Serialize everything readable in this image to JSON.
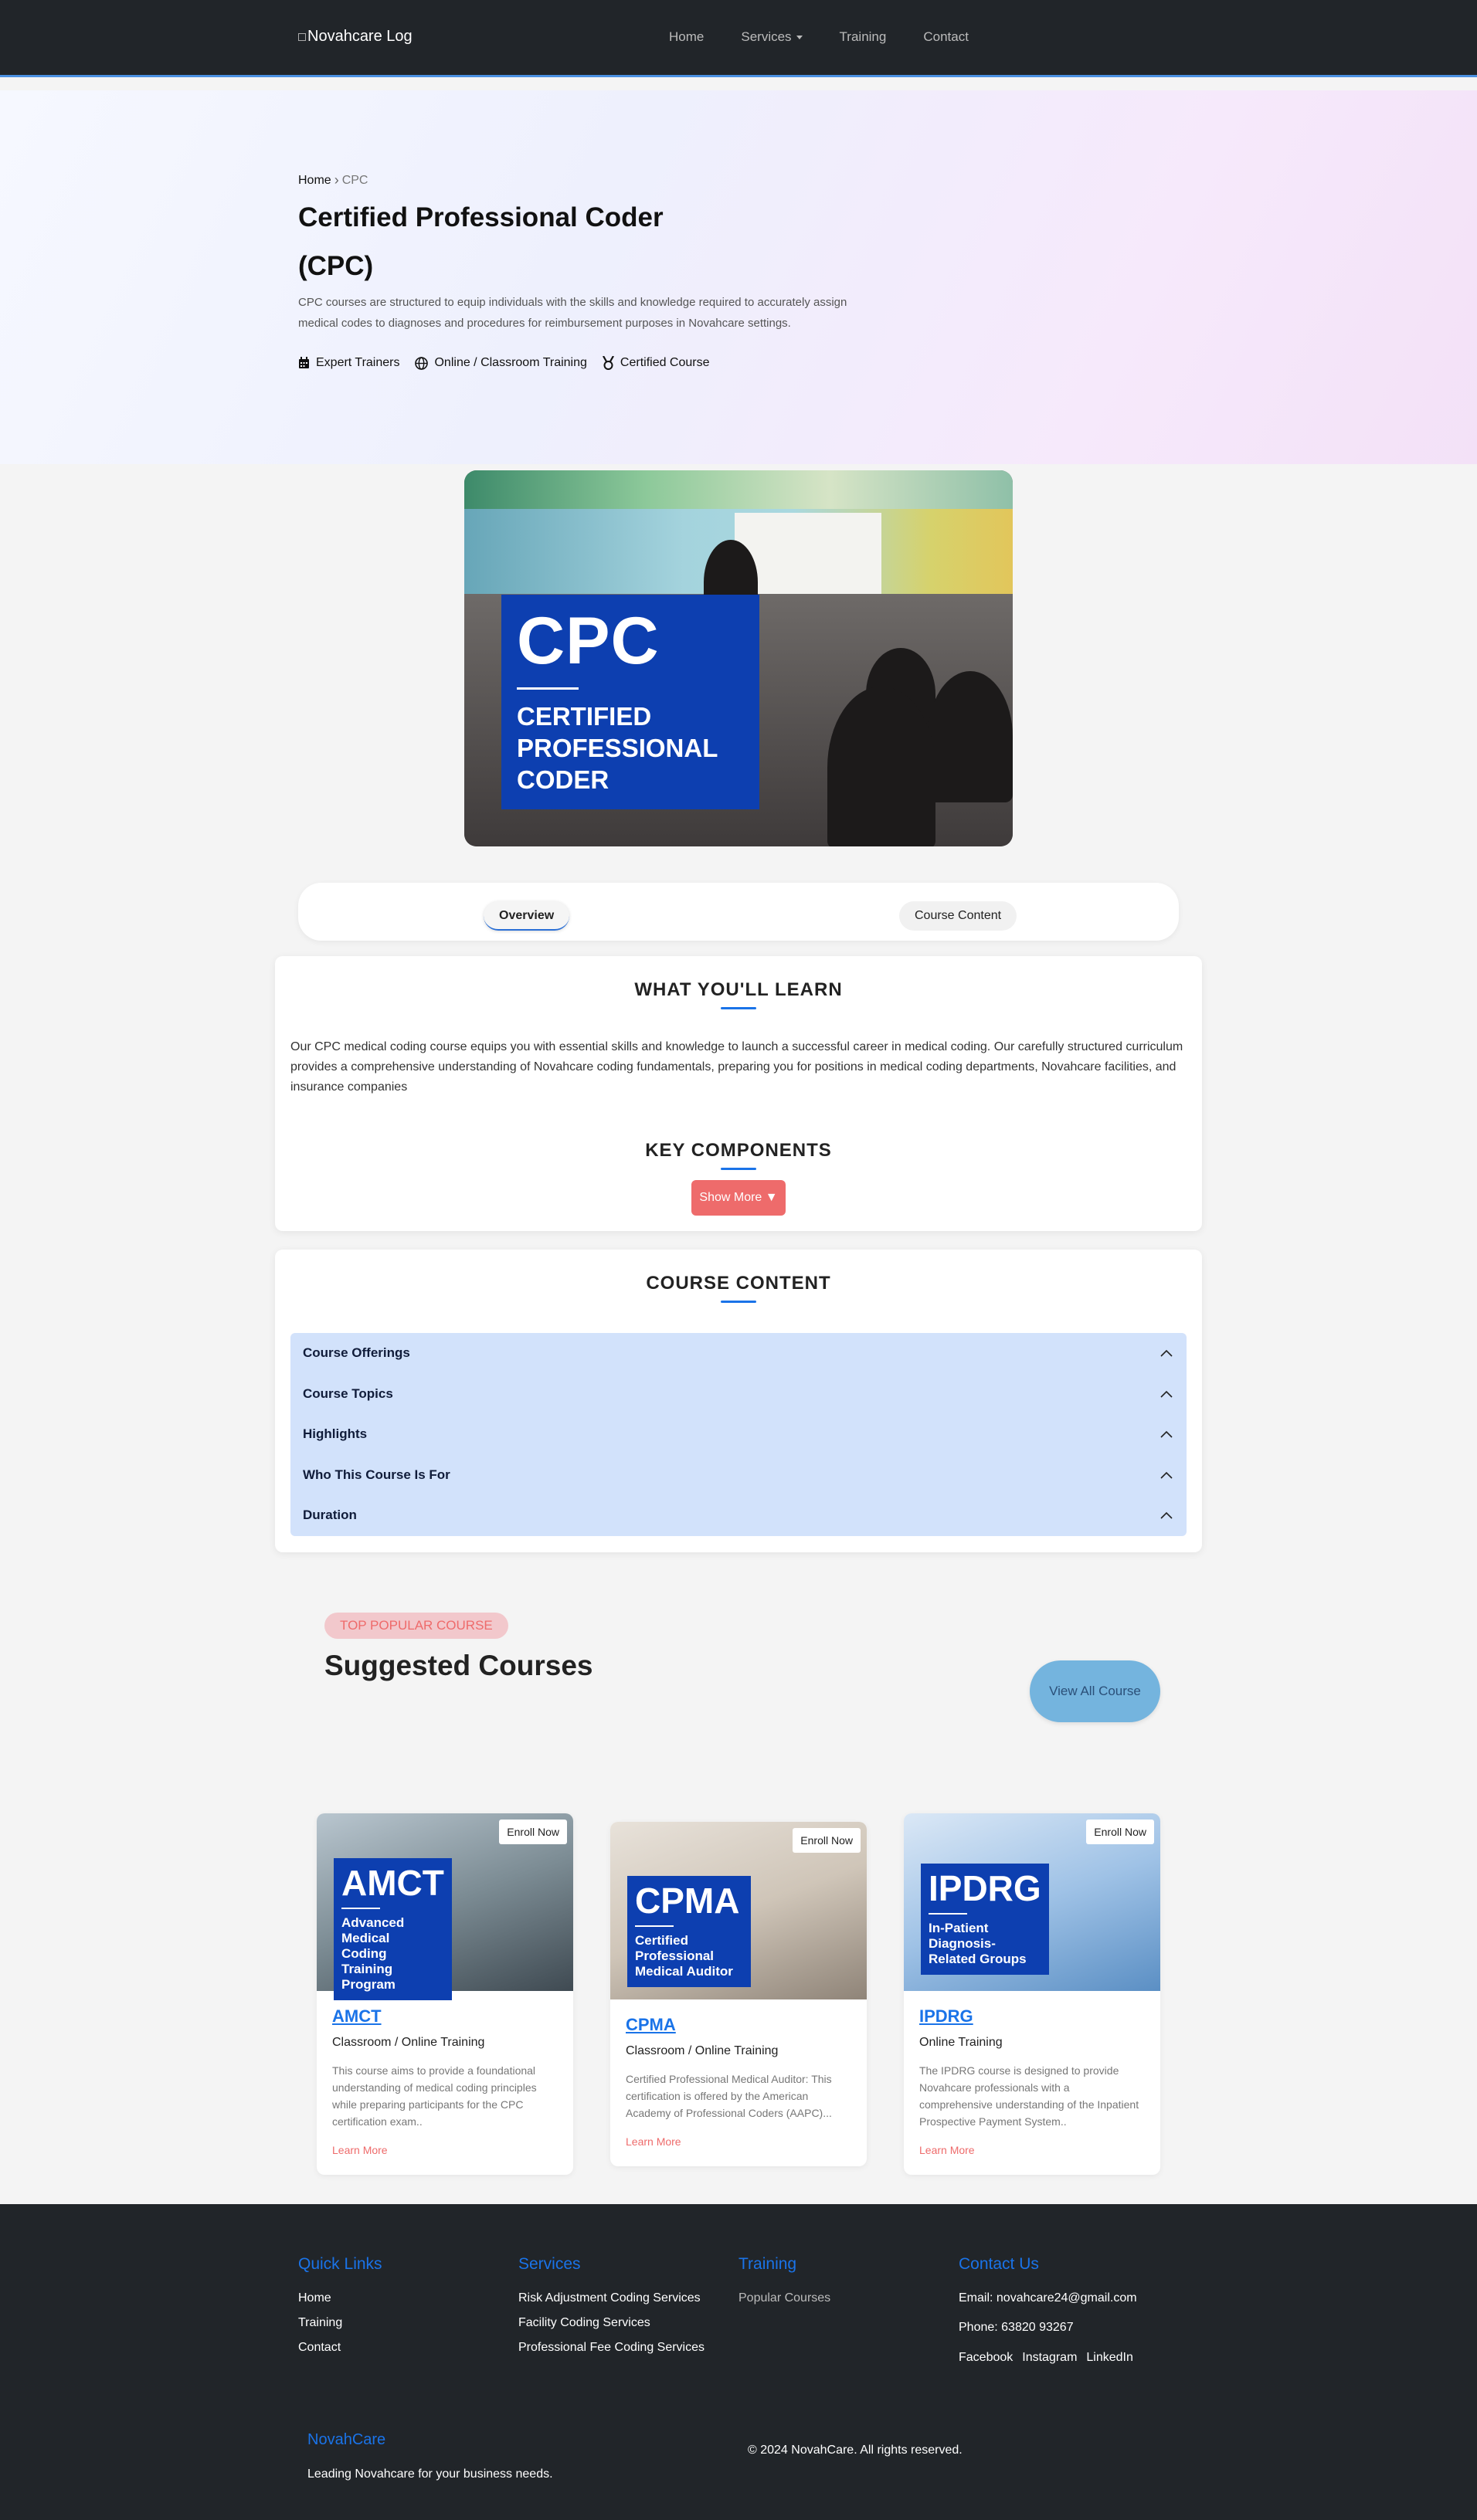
{
  "nav": {
    "logo_alt": "Novahcare Log",
    "links": [
      "Home",
      "Services",
      "Training",
      "Contact"
    ]
  },
  "hero": {
    "breadcrumb": {
      "home": "Home",
      "current": "CPC"
    },
    "title": "Certified Professional Coder (CPC)",
    "description": "CPC courses are structured to equip individuals with the skills and knowledge required to accurately assign medical codes to diagnoses and procedures for reimbursement purposes in Novahcare settings.",
    "features": [
      "Expert Trainers",
      "Online / Classroom Training",
      "Certified Course"
    ]
  },
  "course_image": {
    "badge_title": "CPC",
    "badge_lines": [
      "CERTIFIED",
      "PROFESSIONAL",
      "CODER"
    ]
  },
  "tabs": [
    "Overview",
    "Course Content"
  ],
  "learn": {
    "title": "WHAT YOU'LL LEARN",
    "body": "Our CPC medical coding course equips you with essential skills and knowledge to launch a successful career in medical coding. Our carefully structured curriculum provides a comprehensive understanding of Novahcare coding fundamentals, preparing you for positions in medical coding departments, Novahcare facilities, and insurance companies",
    "key_title": "KEY COMPONENTS",
    "show_more": "Show More ▼"
  },
  "course_content": {
    "title": "COURSE CONTENT",
    "items": [
      "Course Offerings",
      "Course Topics",
      "Highlights",
      "Who This Course Is For",
      "Duration"
    ]
  },
  "suggested": {
    "pill": "TOP POPULAR COURSE",
    "title": "Suggested Courses",
    "view_all": "View All Course",
    "enroll_label": "Enroll Now",
    "learn_more": "Learn More",
    "courses": [
      {
        "badge": "AMCT",
        "badge_sub": "Advanced Medical Coding Training Program",
        "name": "AMCT",
        "mode": "Classroom / Online Training",
        "desc": "This course aims to provide a foundational understanding of medical coding principles while preparing participants for the CPC certification exam.."
      },
      {
        "badge": "CPMA",
        "badge_sub": "Certified Professional Medical Auditor",
        "name": "CPMA",
        "mode": "Classroom / Online Training",
        "desc": "Certified Professional Medical Auditor: This certification is offered by the American Academy of Professional Coders (AAPC)..."
      },
      {
        "badge": "IPDRG",
        "badge_sub": "In-Patient Diagnosis-Related Groups",
        "name": "IPDRG",
        "mode": "Online Training",
        "desc": "The IPDRG course is designed to provide Novahcare professionals with a comprehensive understanding of the Inpatient Prospective Payment System.."
      }
    ]
  },
  "footer": {
    "quick_links": {
      "title": "Quick Links",
      "items": [
        "Home",
        "Training",
        "Contact"
      ]
    },
    "services": {
      "title": "Services",
      "items": [
        "Risk Adjustment Coding Services",
        "Facility Coding Services",
        "Professional Fee Coding Services"
      ]
    },
    "training": {
      "title": "Training",
      "items": [
        "Popular Courses"
      ]
    },
    "contact": {
      "title": "Contact Us",
      "email": "Email: novahcare24@gmail.com",
      "phone": "Phone: 63820 93267",
      "social": [
        "Facebook",
        "Instagram",
        "LinkedIn"
      ]
    },
    "brand": "NovahCare",
    "tagline": "Leading Novahcare for your business needs.",
    "copyright": "© 2024 NovahCare. All rights reserved."
  },
  "colors": {
    "accent": "#1a73e8",
    "brand_red": "#ee6b6b",
    "badge_blue": "#0d3fb0",
    "dark": "#212529"
  }
}
